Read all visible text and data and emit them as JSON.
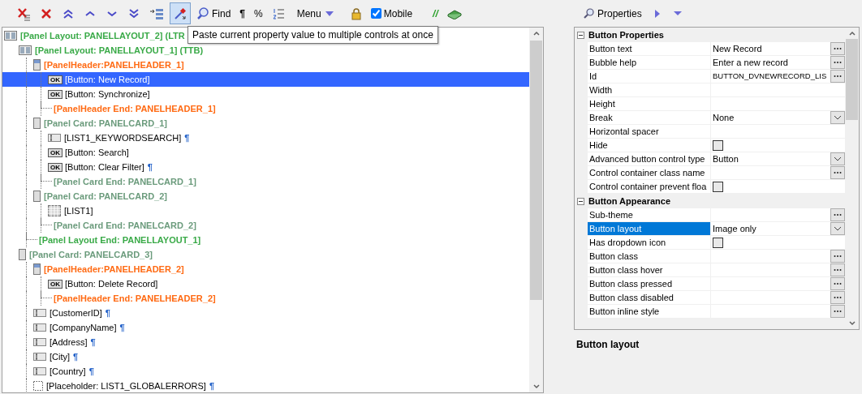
{
  "toolbar": {
    "paste_tool": {
      "selected": true
    },
    "find": "Find",
    "pilcrow": "¶",
    "percent": "%",
    "menu": "Menu",
    "mobile": {
      "label": "Mobile",
      "checked": true
    },
    "comment": "//"
  },
  "tooltip": "Paste current property value to multiple controls at once",
  "tree": [
    {
      "kind": "layout",
      "label": "[Panel Layout: PANELLAYOUT_2] (LTR",
      "selected": false,
      "children": [
        {
          "kind": "layout",
          "label": "[Panel Layout: PANELLAYOUT_1] (TTB)",
          "selected": false,
          "children": [
            {
              "kind": "header",
              "label": "[PanelHeader:PANELHEADER_1]",
              "selected": false,
              "children": [
                {
                  "kind": "button",
                  "icon_text": "OK",
                  "label": "[Button: New Record]",
                  "selected": true
                },
                {
                  "kind": "button",
                  "icon_text": "OK",
                  "label": "[Button: Synchronize]",
                  "selected": false
                },
                {
                  "kind": "header_end",
                  "label": "[PanelHeader End: PANELHEADER_1]",
                  "selected": false
                }
              ]
            },
            {
              "kind": "card",
              "label": "[Panel Card: PANELCARD_1]",
              "selected": false,
              "children": [
                {
                  "kind": "field",
                  "label": "[LIST1_KEYWORDSEARCH]",
                  "mark": "¶",
                  "selected": false
                },
                {
                  "kind": "button",
                  "icon_text": "OK",
                  "label": "[Button: Search]",
                  "selected": false
                },
                {
                  "kind": "button",
                  "icon_text": "OK",
                  "label": "[Button: Clear Filter]",
                  "mark": "¶",
                  "selected": false
                },
                {
                  "kind": "card_end",
                  "label": "[Panel Card End: PANELCARD_1]",
                  "selected": false
                }
              ]
            },
            {
              "kind": "card",
              "label": "[Panel Card: PANELCARD_2]",
              "selected": false,
              "children": [
                {
                  "kind": "list",
                  "label": "[LIST1]",
                  "selected": false
                },
                {
                  "kind": "card_end",
                  "label": "[Panel Card End: PANELCARD_2]",
                  "selected": false
                }
              ]
            },
            {
              "kind": "layout_end",
              "label": "[Panel Layout End: PANELLAYOUT_1]",
              "selected": false
            }
          ]
        },
        {
          "kind": "card",
          "label": "[Panel Card: PANELCARD_3]",
          "selected": false,
          "children": [
            {
              "kind": "header",
              "label": "[PanelHeader:PANELHEADER_2]",
              "selected": false,
              "children": [
                {
                  "kind": "button",
                  "icon_text": "OK",
                  "label": "[Button: Delete Record]",
                  "selected": false
                },
                {
                  "kind": "header_end",
                  "label": "[PanelHeader End: PANELHEADER_2]",
                  "selected": false
                }
              ]
            },
            {
              "kind": "field",
              "label": "[CustomerID]",
              "mark": "¶",
              "selected": false
            },
            {
              "kind": "field",
              "label": "[CompanyName]",
              "mark": "¶",
              "selected": false
            },
            {
              "kind": "field",
              "label": "[Address]",
              "mark": "¶",
              "selected": false
            },
            {
              "kind": "field",
              "label": "[City]",
              "mark": "¶",
              "selected": false
            },
            {
              "kind": "field",
              "label": "[Country]",
              "mark": "¶",
              "selected": false
            },
            {
              "kind": "placeholder",
              "label": "[Placeholder: LIST1_GLOBALERRORS]",
              "mark": "¶",
              "selected": false
            }
          ]
        }
      ]
    }
  ],
  "properties_bar": {
    "label": "Properties"
  },
  "property_grid": [
    {
      "title": "Button Properties",
      "expanded": true,
      "rows": [
        {
          "name": "Button text",
          "value": "New Record",
          "kind": "ellipsis",
          "selected": false
        },
        {
          "name": "Bubble help",
          "value": "Enter a new record",
          "kind": "ellipsis",
          "selected": false
        },
        {
          "name": "Id",
          "value": "BUTTON_DVNEWRECORD_LIS",
          "kind": "ellipsis",
          "selected": false
        },
        {
          "name": "Width",
          "kind": "text",
          "selected": false
        },
        {
          "name": "Height",
          "kind": "text",
          "selected": false
        },
        {
          "name": "Break",
          "value": "None",
          "kind": "dropdown",
          "selected": false
        },
        {
          "name": "Horizontal spacer",
          "kind": "text",
          "selected": false
        },
        {
          "name": "Hide",
          "kind": "checkbox",
          "checked": false,
          "selected": false
        },
        {
          "name": "Advanced button control type",
          "value": "Button",
          "kind": "dropdown",
          "selected": false
        },
        {
          "name": "Control container class name",
          "kind": "ellipsis",
          "selected": false
        },
        {
          "name": "Control container prevent floa",
          "kind": "checkbox",
          "checked": false,
          "selected": false
        }
      ]
    },
    {
      "title": "Button Appearance",
      "expanded": true,
      "rows": [
        {
          "name": "Sub-theme",
          "kind": "ellipsis",
          "selected": false
        },
        {
          "name": "Button layout",
          "value": "Image only",
          "kind": "dropdown",
          "selected": true
        },
        {
          "name": "Has dropdown icon",
          "kind": "checkbox",
          "checked": false,
          "selected": false
        },
        {
          "name": "Button class",
          "kind": "ellipsis",
          "selected": false
        },
        {
          "name": "Button class hover",
          "kind": "ellipsis",
          "selected": false
        },
        {
          "name": "Button class pressed",
          "kind": "ellipsis",
          "selected": false
        },
        {
          "name": "Button class disabled",
          "kind": "ellipsis",
          "selected": false
        },
        {
          "name": "Button inline style",
          "kind": "ellipsis",
          "selected": false
        }
      ]
    }
  ],
  "description_title": "Button layout"
}
